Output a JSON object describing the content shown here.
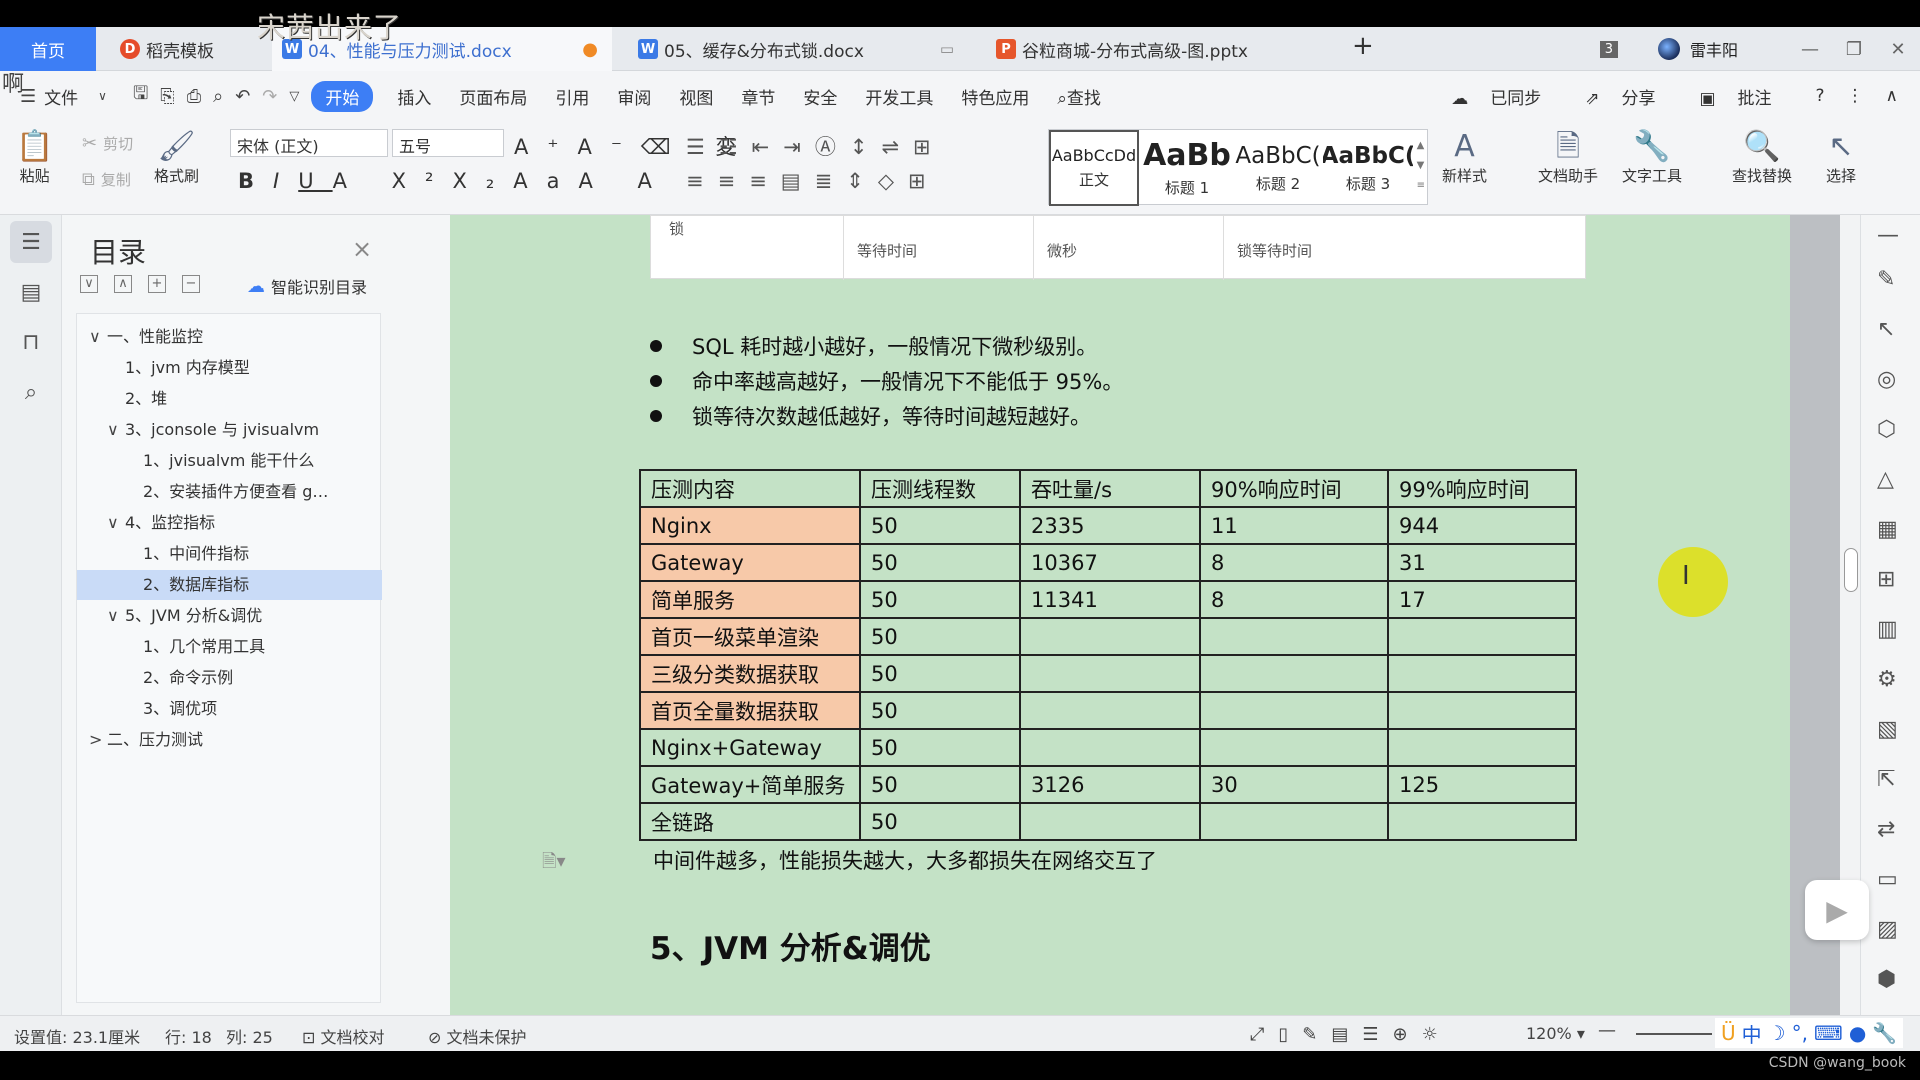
{
  "overlay": {
    "top_text": "宋茜出来了",
    "left_text": "啊"
  },
  "tabs": {
    "home": "首页",
    "daoke": "稻壳模板",
    "doc1": "04、性能与压力测试.docx",
    "doc2": "05、缓存&分布式锁.docx",
    "ppt": "谷粒商城-分布式高级-图.pptx",
    "badge": "3",
    "user": "雷丰阳"
  },
  "menu": {
    "file": "文件",
    "items": [
      "开始",
      "插入",
      "页面布局",
      "引用",
      "审阅",
      "视图",
      "章节",
      "安全",
      "开发工具",
      "特色应用"
    ],
    "search": "查找",
    "synced": "已同步",
    "share": "分享",
    "comment": "批注"
  },
  "ribbon": {
    "paste": "粘贴",
    "cut": "剪切",
    "copy": "复制",
    "format_brush": "格式刷",
    "font": "宋体 (正文)",
    "size": "五号",
    "styles": [
      {
        "sample": "AaBbCcDd",
        "name": "正文"
      },
      {
        "sample": "AaBb",
        "name": "标题 1"
      },
      {
        "sample": "AaBbC(",
        "name": "标题 2"
      },
      {
        "sample": "AaBbC(",
        "name": "标题 3"
      }
    ],
    "new_style": "新样式",
    "doc_helper": "文档助手",
    "text_tools": "文字工具",
    "find_replace": "查找替换",
    "select": "选择"
  },
  "toc": {
    "title": "目录",
    "smart": "智能识别目录",
    "items": [
      {
        "label": "一、性能监控",
        "level": 0,
        "chev": "∨"
      },
      {
        "label": "1、jvm 内存模型",
        "level": 1,
        "chev": ""
      },
      {
        "label": "2、堆",
        "level": 1,
        "chev": ""
      },
      {
        "label": "3、jconsole 与 jvisualvm",
        "level": 1,
        "chev": "∨"
      },
      {
        "label": "1、jvisualvm 能干什么",
        "level": 2,
        "chev": ""
      },
      {
        "label": "2、安装插件方便查看 g…",
        "level": 2,
        "chev": ""
      },
      {
        "label": "4、监控指标",
        "level": 1,
        "chev": "∨"
      },
      {
        "label": "1、中间件指标",
        "level": 2,
        "chev": ""
      },
      {
        "label": "2、数据库指标",
        "level": 2,
        "chev": "",
        "active": true
      },
      {
        "label": "5、JVM 分析&调优",
        "level": 1,
        "chev": "∨"
      },
      {
        "label": "1、几个常用工具",
        "level": 2,
        "chev": ""
      },
      {
        "label": "2、命令示例",
        "level": 2,
        "chev": ""
      },
      {
        "label": "3、调优项",
        "level": 2,
        "chev": ""
      },
      {
        "label": "二、压力测试",
        "level": 0,
        "chev": ">"
      }
    ]
  },
  "doc": {
    "header_row": {
      "c1": "锁",
      "c2": "等待时间",
      "c3": "微秒",
      "c4": "锁等待时间"
    },
    "bullets": [
      "SQL 耗时越小越好，一般情况下微秒级别。",
      "命中率越高越好，一般情况下不能低于 95%。",
      "锁等待次数越低越好，等待时间越短越好。"
    ],
    "table": {
      "headers": [
        "压测内容",
        "压测线程数",
        "吞吐量/s",
        "90%响应时间",
        "99%响应时间"
      ],
      "rows": [
        [
          "Nginx",
          "50",
          "2335",
          "11",
          "944"
        ],
        [
          "Gateway",
          "50",
          "10367",
          "8",
          "31"
        ],
        [
          "简单服务",
          "50",
          "11341",
          "8",
          "17"
        ],
        [
          "首页一级菜单渲染",
          "50",
          "",
          "",
          ""
        ],
        [
          "三级分类数据获取",
          "50",
          "",
          "",
          ""
        ],
        [
          "首页全量数据获取",
          "50",
          "",
          "",
          ""
        ],
        [
          "Nginx+Gateway",
          "50",
          "",
          "",
          ""
        ],
        [
          "Gateway+简单服务",
          "50",
          "3126",
          "30",
          "125"
        ],
        [
          "全链路",
          "50",
          "",
          "",
          ""
        ]
      ]
    },
    "note": "中间件越多，性能损失越大，大多都损失在网络交互了",
    "heading": "5、JVM 分析&调优"
  },
  "status": {
    "setting": "设置值: 23.1厘米",
    "row": "行: 18",
    "col": "列: 25",
    "proof": "文档校对",
    "protect": "文档未保护",
    "zoom": "120%"
  },
  "ime": {
    "lang": "中"
  },
  "watermark": "CSDN @wang_book"
}
